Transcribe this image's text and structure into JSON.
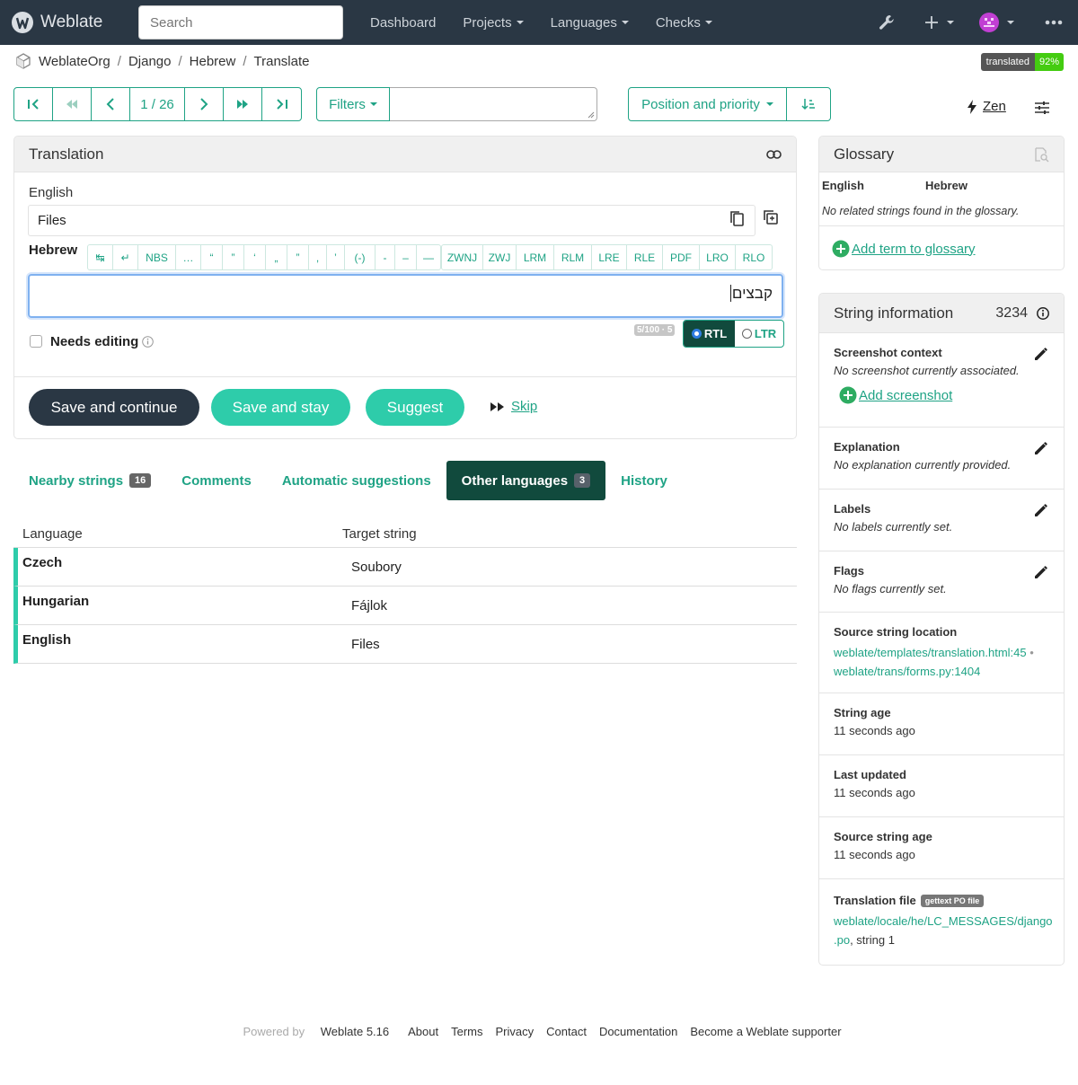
{
  "nav": {
    "brand": "Weblate",
    "search_placeholder": "Search",
    "links": [
      {
        "label": "Dashboard",
        "caret": false
      },
      {
        "label": "Projects",
        "caret": true
      },
      {
        "label": "Languages",
        "caret": true
      },
      {
        "label": "Checks",
        "caret": true
      }
    ],
    "icons": [
      "wrench-icon",
      "plus-icon",
      "avatar",
      "more-icon"
    ]
  },
  "breadcrumb": [
    "WeblateOrg",
    "Django",
    "Hebrew",
    "Translate"
  ],
  "status_badge": {
    "label": "translated",
    "value": "92%"
  },
  "toolbar": {
    "position": "1 / 26",
    "filters_label": "Filters",
    "search_value": "",
    "sort_label": "Position and priority",
    "zen_label": "Zen"
  },
  "translation": {
    "title": "Translation",
    "source_lang": "English",
    "source_text": "Files",
    "target_lang": "Hebrew",
    "target_text": "קבצים",
    "special_chars": [
      "↹",
      "↵",
      "NBS",
      "…",
      "“",
      "”",
      "‘",
      "„",
      "”",
      ",",
      "’",
      "(-)",
      "-",
      "–",
      "—"
    ],
    "direction_chars": [
      "ZWNJ",
      "ZWJ",
      "LRM",
      "RLM",
      "LRE",
      "RLE",
      "PDF",
      "LRO",
      "RLO"
    ],
    "counter": "5/100 · 5",
    "dir_rtl": "RTL",
    "dir_ltr": "LTR",
    "needs_editing": "Needs editing",
    "buttons": {
      "save_continue": "Save and continue",
      "save_stay": "Save and stay",
      "suggest": "Suggest",
      "skip": "Skip"
    }
  },
  "tabs": [
    {
      "label": "Nearby strings",
      "count": "16"
    },
    {
      "label": "Comments",
      "count": ""
    },
    {
      "label": "Automatic suggestions",
      "count": ""
    },
    {
      "label": "Other languages",
      "count": "3",
      "active": true
    },
    {
      "label": "History",
      "count": ""
    }
  ],
  "other_languages": {
    "headers": [
      "Language",
      "Target string"
    ],
    "rows": [
      {
        "language": "Czech",
        "target": "Soubory"
      },
      {
        "language": "Hungarian",
        "target": "Fájlok"
      },
      {
        "language": "English",
        "target": "Files"
      }
    ]
  },
  "glossary": {
    "title": "Glossary",
    "col_source": "English",
    "col_target": "Hebrew",
    "empty": "No related strings found in the glossary.",
    "add_term": "Add term to glossary"
  },
  "string_info": {
    "title": "String information",
    "id": "3234",
    "screenshot": {
      "title": "Screenshot context",
      "text": "No screenshot currently associated.",
      "link": "Add screenshot"
    },
    "explanation": {
      "title": "Explanation",
      "text": "No explanation currently provided."
    },
    "labels": {
      "title": "Labels",
      "text": "No labels currently set."
    },
    "flags": {
      "title": "Flags",
      "text": "No flags currently set."
    },
    "location": {
      "title": "Source string location",
      "link1": "weblate/templates/translation.html:45",
      "sep": " •",
      "link2": "weblate/trans/forms.py:1404"
    },
    "string_age": {
      "title": "String age",
      "text": "11 seconds ago"
    },
    "last_updated": {
      "title": "Last updated",
      "text": "11 seconds ago"
    },
    "source_age": {
      "title": "Source string age",
      "text": "11 seconds ago"
    },
    "file": {
      "title": "Translation file",
      "badge": "gettext PO file",
      "link1": "weblate/locale/he/LC_MESSAGES/django",
      "link2": ".po",
      "suffix": ", string 1"
    }
  },
  "footer": {
    "powered_by": "Powered by",
    "version": "Weblate 5.16",
    "links": [
      "About",
      "Terms",
      "Privacy",
      "Contact",
      "Documentation",
      "Become a Weblate supporter"
    ]
  },
  "colors": {
    "accent": "#1fa385",
    "nav_bg": "#2a3744",
    "dark_button": "#2a3744",
    "accent_button": "#2eccaa",
    "badge_green": "#44cc11"
  }
}
